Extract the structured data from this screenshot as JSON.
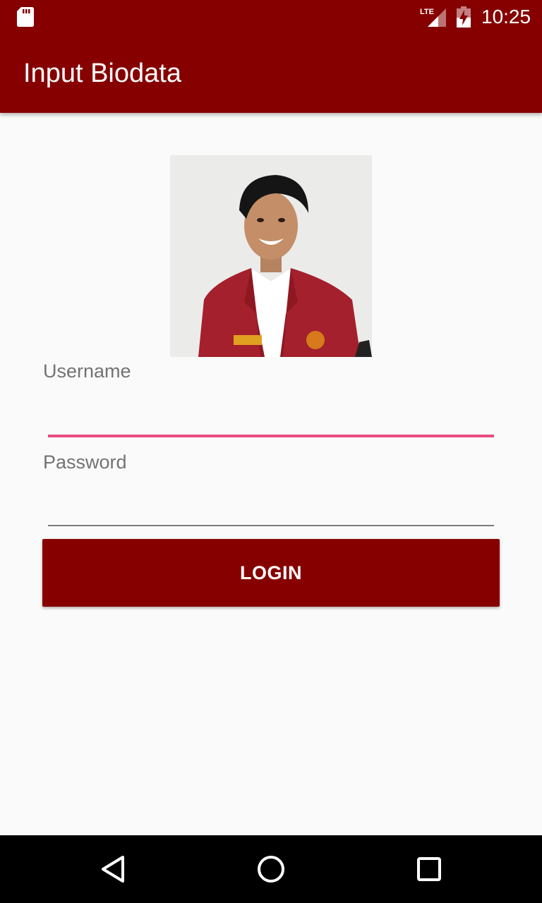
{
  "status_bar": {
    "time": "10:25",
    "network_label": "LTE",
    "icons": [
      "sd-card-icon",
      "lte-signal-icon",
      "battery-charging-icon"
    ]
  },
  "app_bar": {
    "title": "Input Biodata"
  },
  "profile": {
    "photo_subject": "student portrait in red jacket"
  },
  "form": {
    "username_label": "Username",
    "username_value": "",
    "password_label": "Password",
    "password_value": "",
    "login_label": "LOGIN"
  },
  "nav_bar": {
    "icons": [
      "back-icon",
      "home-icon",
      "recents-icon"
    ]
  },
  "colors": {
    "primary": "#860000",
    "accent": "#e94d7f",
    "background": "#fafafa",
    "label": "#737373"
  }
}
